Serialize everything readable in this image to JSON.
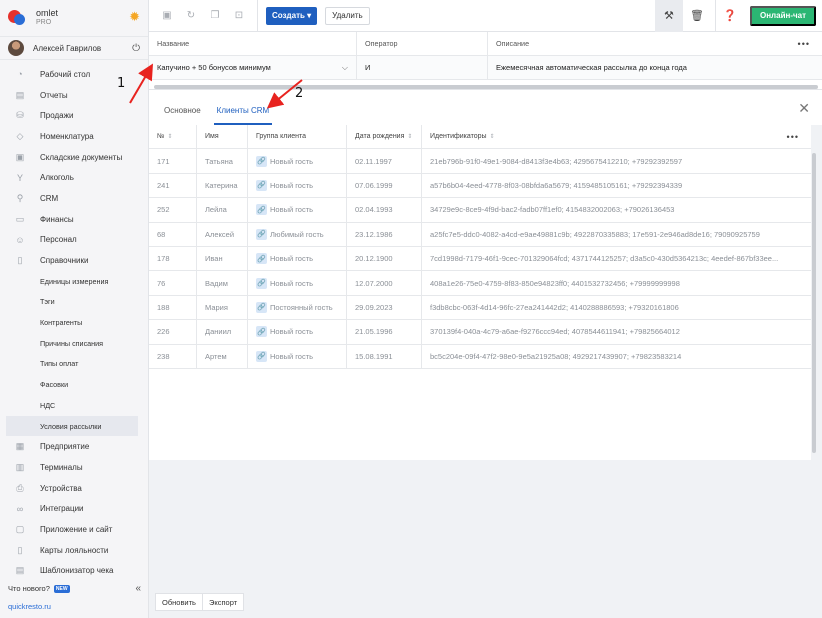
{
  "brand": {
    "name": "omlet",
    "tier": "PRO"
  },
  "user": {
    "name": "Алексей Гаврилов"
  },
  "menu": [
    {
      "label": "Рабочий стол",
      "icon": "gauge-icon",
      "glyph": "◔"
    },
    {
      "label": "Отчеты",
      "icon": "chart-icon",
      "glyph": "▤"
    },
    {
      "label": "Продажи",
      "icon": "basket-icon",
      "glyph": "⛁"
    },
    {
      "label": "Номенклатура",
      "icon": "tag-icon",
      "glyph": "◇"
    },
    {
      "label": "Складские документы",
      "icon": "box-icon",
      "glyph": "▣"
    },
    {
      "label": "Алкоголь",
      "icon": "glass-icon",
      "glyph": "Y"
    },
    {
      "label": "CRM",
      "icon": "crm-icon",
      "glyph": "⚲"
    },
    {
      "label": "Финансы",
      "icon": "wallet-icon",
      "glyph": "▭"
    },
    {
      "label": "Персонал",
      "icon": "staff-icon",
      "glyph": "☺"
    },
    {
      "label": "Справочники",
      "icon": "book-icon",
      "glyph": "▯",
      "bold": true
    }
  ],
  "submenu": [
    "Единицы измерения",
    "Тэги",
    "Контрагенты",
    "Причины списания",
    "Типы оплат",
    "Фасовки",
    "НДС",
    "Условия рассылки"
  ],
  "submenu_active": 7,
  "menu2": [
    {
      "label": "Предприятие",
      "icon": "building-icon",
      "glyph": "▦"
    },
    {
      "label": "Терминалы",
      "icon": "terminal-icon",
      "glyph": "▥"
    },
    {
      "label": "Устройства",
      "icon": "printer-icon",
      "glyph": "⎙"
    },
    {
      "label": "Интеграции",
      "icon": "integration-icon",
      "glyph": "∞"
    },
    {
      "label": "Приложение и сайт",
      "icon": "app-icon",
      "glyph": "▢"
    },
    {
      "label": "Карты лояльности",
      "icon": "card-icon",
      "glyph": "▯"
    },
    {
      "label": "Шаблонизатор чека",
      "icon": "receipt-icon",
      "glyph": "▤"
    }
  ],
  "whatsnew": {
    "label": "Что нового?",
    "badge": "NEW"
  },
  "site_link": "quickresto.ru",
  "toolbar": {
    "create_label": "Создать ▾",
    "delete_label": "Удалить",
    "chat_label": "Онлайн-чат"
  },
  "topgrid": {
    "headers": [
      "Название",
      "Оператор",
      "Описание"
    ],
    "row": [
      "Капучино + 50 бонусов минимум",
      "И",
      "Ежемесячная автоматическая рассылка до конца года"
    ]
  },
  "tabs": [
    "Основное",
    "Клиенты CRM"
  ],
  "tab_active": 1,
  "table": {
    "headers": [
      "№",
      "Имя",
      "Группа клиента",
      "Дата рождения",
      "Идентификаторы"
    ],
    "rows": [
      [
        "171",
        "Татьяна",
        "Новый гость",
        "02.11.1997",
        "21eb796b-91f0-49e1-9084-d8413f3e4b63; 4295675412210; +79292392597"
      ],
      [
        "241",
        "Катерина",
        "Новый гость",
        "07.06.1999",
        "a57b6b04-4eed-4778-8f03-08bfda6a5679; 4159485105161; +79292394339"
      ],
      [
        "252",
        "Лейла",
        "Новый гость",
        "02.04.1993",
        "34729e9c-8ce9-4f9d-bac2-fadb07ff1ef0; 4154832002063; +79026136453"
      ],
      [
        "68",
        "Алексей",
        "Любимый гость",
        "23.12.1986",
        "a25fc7e5-ddc0-4082-a4cd-e9ae49881c9b; 4922870335883; 17e591-2e946ad8de16; 79090925759"
      ],
      [
        "178",
        "Иван",
        "Новый гость",
        "20.12.1900",
        "7cd1998d-7179-46f1-9cec-701329064fcd; 4371744125257; d3a5c0-430d5364213c; 4eedef-867bf33ee..."
      ],
      [
        "76",
        "Вадим",
        "Новый гость",
        "12.07.2000",
        "408a1e26-75e0-4759-8f83-850e94823ff0; 4401532732456; +79999999998"
      ],
      [
        "188",
        "Мария",
        "Постоянный гость",
        "29.09.2023",
        "f3db8cbc-063f-4d14-96fc-27ea241442d2; 4140288886593; +79320161806"
      ],
      [
        "226",
        "Даниил",
        "Новый гость",
        "21.05.1996",
        "370139f4-040a-4c79-a6ae-f9276ccc94ed; 4078544611941; +79825664012"
      ],
      [
        "238",
        "Артем",
        "Новый гость",
        "15.08.1991",
        "bc5c204e-09f4-47f2-98e0-9e5a21925a08; 4929217439907; +79823583214"
      ]
    ]
  },
  "footer": {
    "refresh_label": "Обновить",
    "export_label": "Экспорт"
  },
  "annotations": {
    "arrow1": "1",
    "arrow2": "2",
    "color": "#e8231f"
  }
}
